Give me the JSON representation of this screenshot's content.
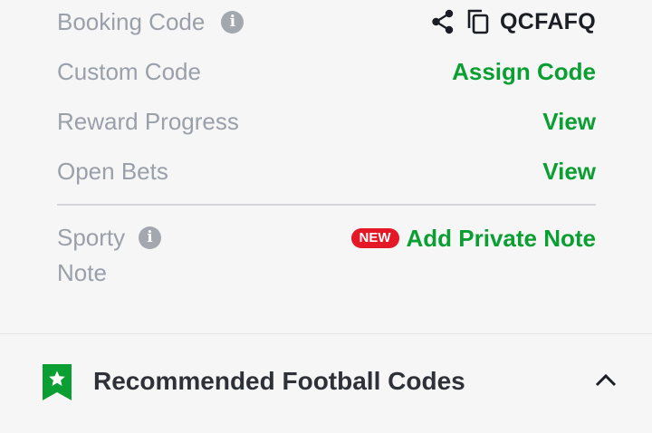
{
  "booking": {
    "label": "Booking Code",
    "code": "QCFAFQ",
    "icons": [
      "info-icon",
      "share-icon",
      "copy-icon"
    ]
  },
  "custom_code": {
    "label": "Custom Code",
    "action": "Assign Code"
  },
  "reward_progress": {
    "label": "Reward Progress",
    "action": "View"
  },
  "open_bets": {
    "label": "Open Bets",
    "action": "View"
  },
  "sporty_note": {
    "label_line1": "Sporty",
    "label_line2": "Note",
    "badge": "NEW",
    "action": "Add Private Note"
  },
  "recommended": {
    "title": "Recommended Football Codes",
    "icon": "bookmark-star-icon",
    "expanded": true
  },
  "colors": {
    "accent_green": "#0b9e32",
    "label_gray": "#9aa0aa",
    "badge_red": "#e41827",
    "background": "#f6f6f7"
  }
}
